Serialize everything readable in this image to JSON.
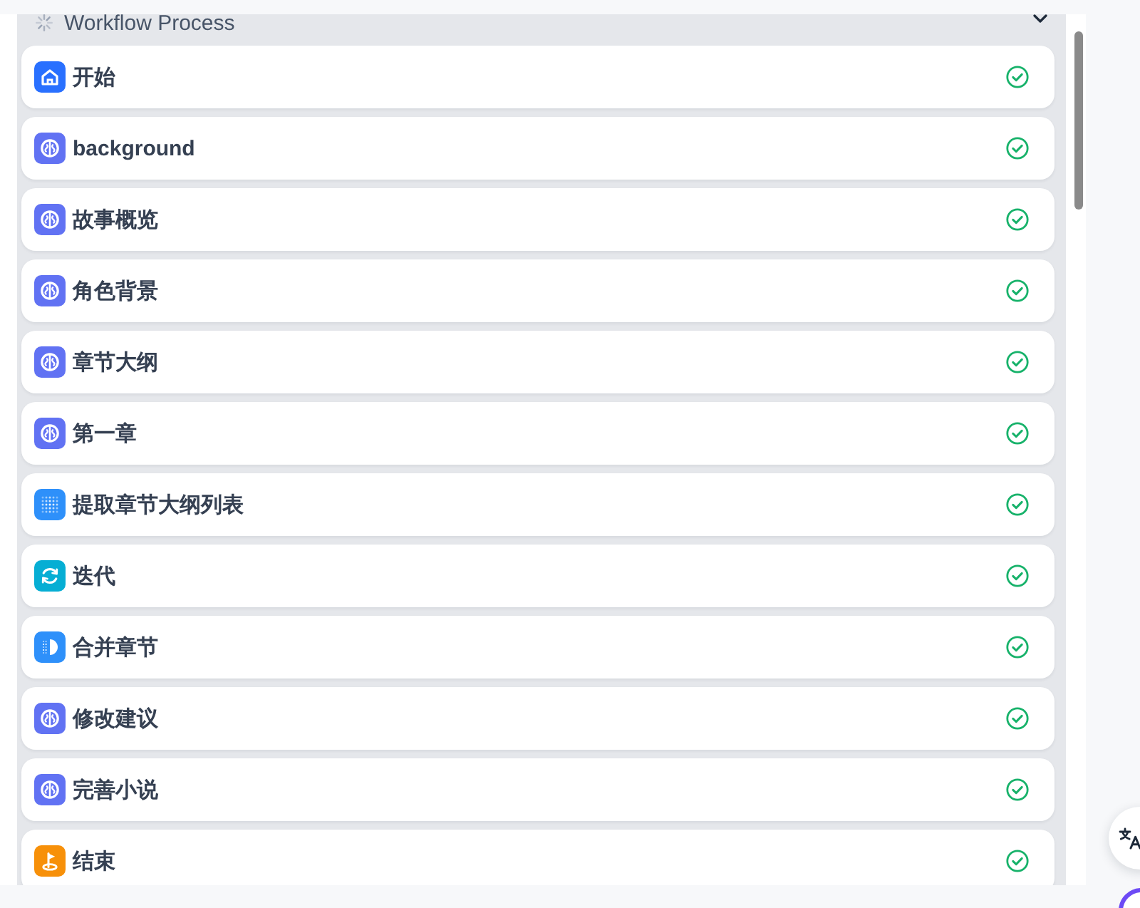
{
  "workflow": {
    "title": "Workflow Process",
    "loading": true,
    "expanded": true,
    "nodes": [
      {
        "kind": "start",
        "title": "开始",
        "completed": true
      },
      {
        "kind": "llm",
        "title": "background",
        "completed": true
      },
      {
        "kind": "llm",
        "title": "故事概览",
        "completed": true
      },
      {
        "kind": "llm",
        "title": "角色背景",
        "completed": true
      },
      {
        "kind": "llm",
        "title": "章节大纲",
        "completed": true
      },
      {
        "kind": "llm",
        "title": "第一章",
        "completed": true
      },
      {
        "kind": "parameter-extractor",
        "title": "提取章节大纲列表",
        "completed": true
      },
      {
        "kind": "iteration",
        "title": "迭代",
        "completed": true
      },
      {
        "kind": "template",
        "title": "合并章节",
        "completed": true
      },
      {
        "kind": "llm",
        "title": "修改建议",
        "completed": true
      },
      {
        "kind": "llm",
        "title": "完善小说",
        "completed": true
      },
      {
        "kind": "end",
        "title": "结束",
        "completed": true
      }
    ]
  }
}
